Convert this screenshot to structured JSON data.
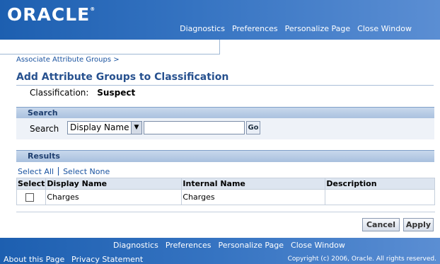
{
  "brand": {
    "logo_text": "ORACLE",
    "logo_mark": "®"
  },
  "global_links": [
    "Diagnostics",
    "Preferences",
    "Personalize Page",
    "Close Window"
  ],
  "breadcrumb": {
    "item": "Associate Attribute Groups",
    "separator": ">"
  },
  "page_title": "Add Attribute Groups to Classification",
  "classification": {
    "label": "Classification:",
    "value": "Suspect"
  },
  "search": {
    "header": "Search",
    "label": "Search",
    "selected_option": "Display Name",
    "input_value": "",
    "go_label": "Go"
  },
  "results": {
    "header": "Results",
    "select_all": "Select All",
    "select_none": "Select None",
    "columns": [
      "Select",
      "Display Name",
      "Internal Name",
      "Description"
    ],
    "rows": [
      {
        "checked": false,
        "display_name": "Charges",
        "internal_name": "Charges",
        "description": ""
      }
    ]
  },
  "buttons": {
    "cancel": "Cancel",
    "apply": "Apply"
  },
  "footer": {
    "links": [
      "Diagnostics",
      "Preferences",
      "Personalize Page",
      "Close Window"
    ],
    "about": "About this Page",
    "privacy": "Privacy Statement",
    "copyright": "Copyright (c) 2006, Oracle. All rights reserved."
  },
  "colors": {
    "brand_blue": "#2f6cbf",
    "link": "#1a53a0",
    "title": "#27518f"
  }
}
